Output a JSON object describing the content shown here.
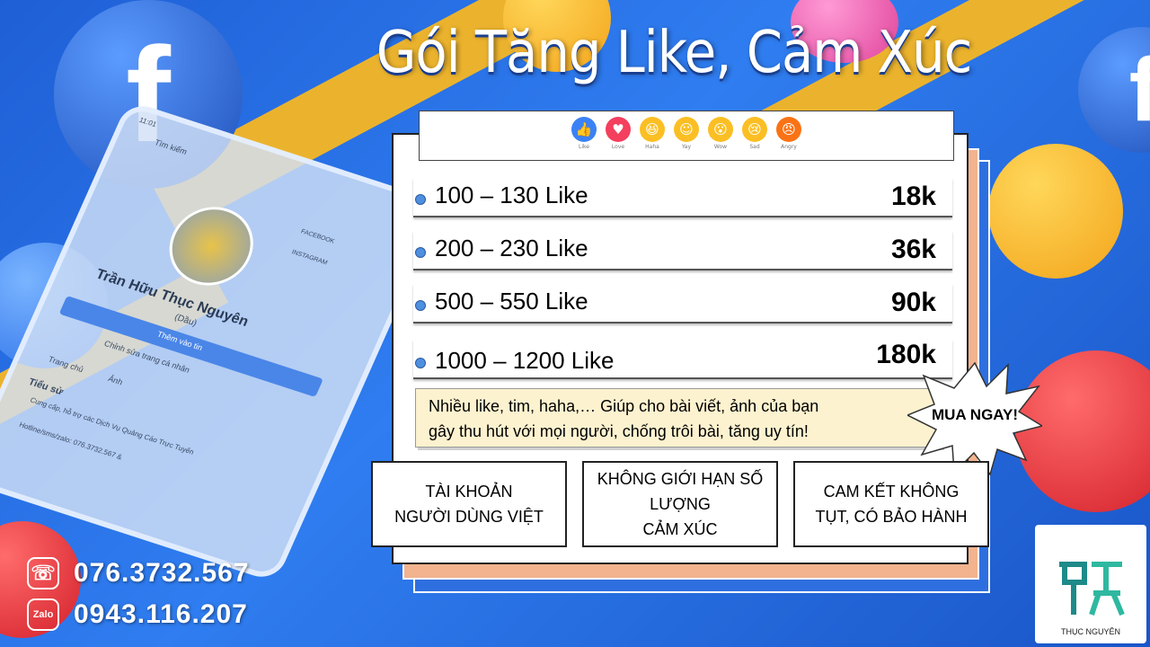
{
  "title": "Gói Tăng Like, Cảm Xúc",
  "reactions": [
    {
      "label": "Like",
      "icon": "thumbs-up-icon",
      "color": "#3b82f6",
      "glyph": "👍"
    },
    {
      "label": "Love",
      "icon": "heart-icon",
      "color": "#f43f5e",
      "glyph": "♥"
    },
    {
      "label": "Haha",
      "icon": "laugh-icon",
      "color": "#fbbf24",
      "glyph": "😆"
    },
    {
      "label": "Yay",
      "icon": "smile-icon",
      "color": "#fbbf24",
      "glyph": "☺"
    },
    {
      "label": "Wow",
      "icon": "wow-icon",
      "color": "#fbbf24",
      "glyph": "😮"
    },
    {
      "label": "Sad",
      "icon": "sad-icon",
      "color": "#fbbf24",
      "glyph": "😢"
    },
    {
      "label": "Angry",
      "icon": "angry-icon",
      "color": "#f97316",
      "glyph": "😠"
    }
  ],
  "packages": [
    {
      "quantity": "100 – 130 Like",
      "price": "18k"
    },
    {
      "quantity": "200 – 230 Like",
      "price": "36k"
    },
    {
      "quantity": "500 – 550 Like",
      "price": "90k"
    },
    {
      "quantity": "1000 – 1200 Like",
      "price": "180k"
    }
  ],
  "note": {
    "line1": "Nhiều like, tim, haha,… Giúp cho bài viết, ảnh của bạn",
    "line2": "gây thu hút với mọi người, chống trôi bài, tăng uy tín!"
  },
  "cta": "MUA NGAY!",
  "features": [
    {
      "line1": "TÀI KHOẢN",
      "line2": "NGƯỜI DÙNG VIỆT"
    },
    {
      "line1": "KHÔNG GIỚI HẠN SỐ LƯỢNG",
      "line2": "CẢM XÚC"
    },
    {
      "line1": "CAM KẾT KHÔNG",
      "line2": "TỤT, CÓ BẢO HÀNH"
    }
  ],
  "contacts": [
    {
      "icon": "phone-icon",
      "icon_text": "☏",
      "number": "076.3732.567"
    },
    {
      "icon": "zalo-icon",
      "icon_text": "Zalo",
      "number": "0943.116.207"
    }
  ],
  "phone_mock": {
    "time": "11:01",
    "search": "Tìm kiếm",
    "name": "Trần Hữu Thục Nguyên",
    "nickname": "(Dầu)",
    "add_story": "Thêm vào tin",
    "edit_profile": "Chỉnh sửa trang cá nhân",
    "tab_home": "Trang chủ",
    "tab_photos": "Ảnh",
    "bio_title": "Tiểu sử",
    "bio_text": "Cung cấp, hỗ trợ các Dịch Vụ Quảng Cáo Trực Tuyến",
    "hotline": "Hotline/sms/zalo: 076.3732.567 &",
    "link_facebook": "FACEBOOK",
    "link_instagram": "INSTAGRAM"
  },
  "logo": {
    "caption": "THỤC NGUYÊN"
  },
  "colors": {
    "background": "#2f7df0",
    "accent_orange": "#f2b38e",
    "accent_blue": "#2e6fe0",
    "note_bg": "#fdf2cf"
  }
}
